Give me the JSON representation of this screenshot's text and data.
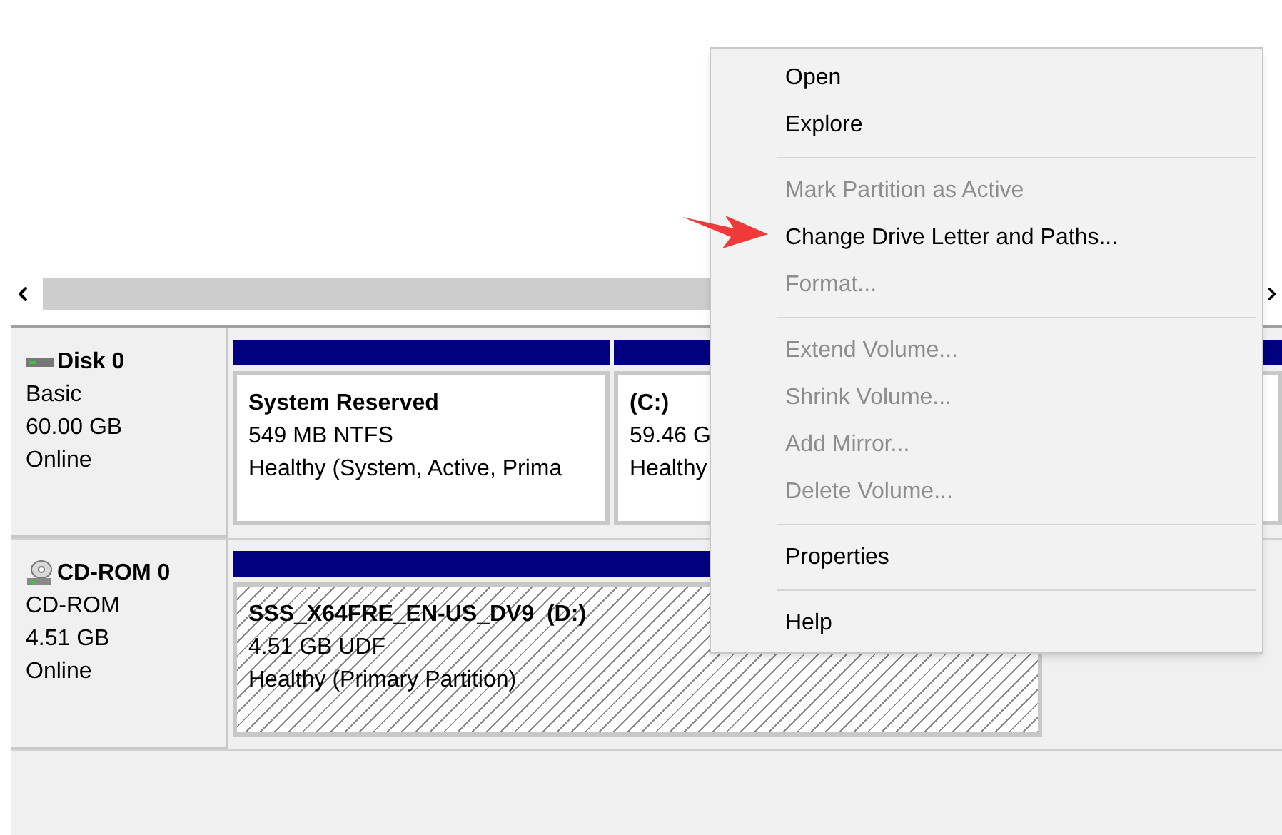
{
  "disks": [
    {
      "kind": "disk",
      "name": "Disk 0",
      "type": "Basic",
      "size": "60.00 GB",
      "status": "Online",
      "partitions": [
        {
          "title": "System Reserved",
          "size": "549 MB NTFS",
          "health": "Healthy (System, Active, Prima",
          "hatched": false
        },
        {
          "title": "(C:)",
          "size": "59.46 G",
          "health": "Healthy",
          "hatched": false
        }
      ]
    },
    {
      "kind": "cdrom",
      "name": "CD-ROM 0",
      "type": "CD-ROM",
      "size": "4.51 GB",
      "status": "Online",
      "partitions": [
        {
          "title": "SSS_X64FRE_EN-US_DV9  (D:)",
          "size": "4.51 GB UDF",
          "health": "Healthy (Primary Partition)",
          "hatched": true
        }
      ]
    }
  ],
  "context_menu": {
    "items": [
      {
        "kind": "item",
        "label": "Open",
        "disabled": false
      },
      {
        "kind": "item",
        "label": "Explore",
        "disabled": false
      },
      {
        "kind": "separator"
      },
      {
        "kind": "item",
        "label": "Mark Partition as Active",
        "disabled": true
      },
      {
        "kind": "item",
        "label": "Change Drive Letter and Paths...",
        "disabled": false
      },
      {
        "kind": "item",
        "label": "Format...",
        "disabled": true
      },
      {
        "kind": "separator"
      },
      {
        "kind": "item",
        "label": "Extend Volume...",
        "disabled": true
      },
      {
        "kind": "item",
        "label": "Shrink Volume...",
        "disabled": true
      },
      {
        "kind": "item",
        "label": "Add Mirror...",
        "disabled": true
      },
      {
        "kind": "item",
        "label": "Delete Volume...",
        "disabled": true
      },
      {
        "kind": "separator"
      },
      {
        "kind": "item",
        "label": "Properties",
        "disabled": false
      },
      {
        "kind": "separator"
      },
      {
        "kind": "item",
        "label": "Help",
        "disabled": false
      }
    ]
  }
}
